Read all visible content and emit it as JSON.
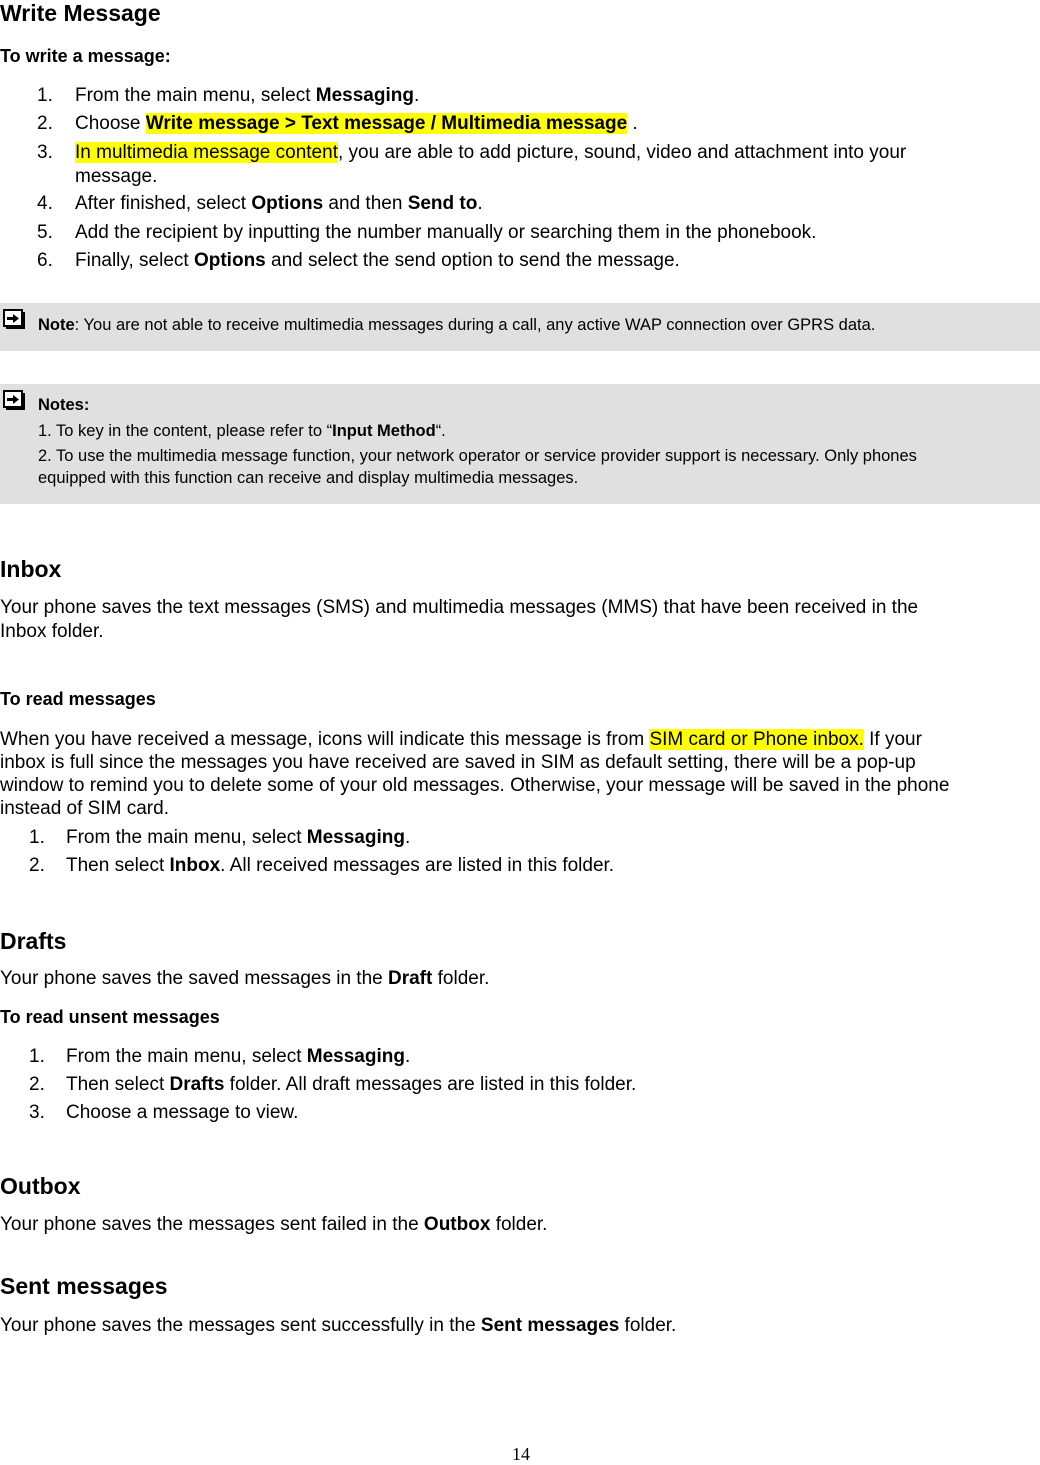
{
  "write_message": {
    "title": "Write Message",
    "subtitle": "To write a message:",
    "steps": [
      {
        "num": "1.",
        "pre": "From the main menu, select ",
        "bold": "Messaging",
        "post": "."
      },
      {
        "num": "2.",
        "pre": "Choose ",
        "highlight_bold": "Write message > Text message / Multimedia message",
        "post": " ."
      },
      {
        "num": "3.",
        "highlight": "In multimedia message content",
        "post": ", you are able to add picture, sound, video and attachment into your",
        "line2": "message."
      },
      {
        "num": "4.",
        "pre": "After finished, select ",
        "bold": "Options",
        "mid": " and then ",
        "bold2": "Send to",
        "post": "."
      },
      {
        "num": "5.",
        "text": "Add the recipient by inputting the number manually or searching them in the phonebook."
      },
      {
        "num": "6.",
        "pre": "Finally, select ",
        "bold": "Options",
        "post": " and select the send option to send the message."
      }
    ]
  },
  "note1": {
    "icon": "arrow-right-box-icon",
    "label": "Note",
    "text": ": You are not able to receive multimedia messages during a call, any active WAP connection over GPRS data."
  },
  "note2": {
    "icon": "arrow-right-box-icon",
    "label": "Notes:",
    "item1_pre": "1. To key in the content, please refer to “",
    "item1_bold": "Input Method",
    "item1_post": "“.",
    "item2_line1": "2. To use the multimedia message function, your network operator or service provider support is necessary. Only phones",
    "item2_line2": "equipped with this function can receive and display multimedia messages."
  },
  "inbox": {
    "title": "Inbox",
    "line1": "Your phone saves the text messages (SMS) and multimedia messages (MMS) that have been received in the",
    "line2": "Inbox folder.",
    "sub": "To read messages",
    "p_pre": "When you have received a message, icons will indicate this message is from ",
    "p_highlight": "SIM card or Phone inbox.",
    "p_post": " If your",
    "p_line2": "inbox is full since the messages you have received are saved in SIM as default setting, there will be a pop-up",
    "p_line3": "window to remind you to delete some of your old messages. Otherwise, your message will be saved in the phone",
    "p_line4": "instead of SIM card.",
    "steps": [
      {
        "num": "1.",
        "pre": "From the main menu, select ",
        "bold": "Messaging",
        "post": "."
      },
      {
        "num": "2.",
        "pre": "Then select ",
        "bold": "Inbox",
        "post": ". All received messages are listed in this folder."
      }
    ]
  },
  "drafts": {
    "title": "Drafts",
    "pre": "Your phone saves the saved messages in the ",
    "bold": "Draft",
    "post": " folder.",
    "sub": "To read unsent messages",
    "steps": [
      {
        "num": "1.",
        "pre": "From the main menu, select ",
        "bold": "Messaging",
        "post": "."
      },
      {
        "num": "2.",
        "pre": "Then select ",
        "bold": "Drafts",
        "post": " folder. All draft messages are listed in this folder."
      },
      {
        "num": "3.",
        "text": "Choose a message to view."
      }
    ]
  },
  "outbox": {
    "title": "Outbox",
    "pre": "Your phone saves the messages sent failed in the ",
    "bold": "Outbox",
    "post": " folder."
  },
  "sent": {
    "title": "Sent messages",
    "pre": "Your phone saves the messages sent successfully in the ",
    "bold": "Sent messages",
    "post": " folder."
  },
  "page_number": "14"
}
